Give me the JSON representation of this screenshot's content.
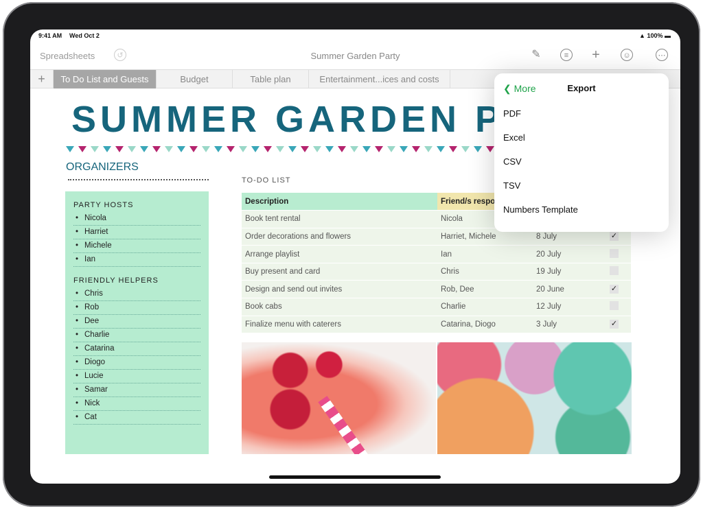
{
  "status": {
    "time": "9:41 AM",
    "date": "Wed Oct 2",
    "battery": "100%"
  },
  "toolbar": {
    "back": "Spreadsheets",
    "title": "Summer Garden Party"
  },
  "icons": [
    "undo-icon",
    "paintbrush-icon",
    "filter-icon",
    "plus-icon",
    "collaborate-icon",
    "more-icon"
  ],
  "tabs": [
    "To Do List and Guests",
    "Budget",
    "Table plan",
    "Entertainment...ices and costs"
  ],
  "doc": {
    "title": "SUMMER GARDEN PARTY",
    "organizers": "ORGANIZERS",
    "sections": [
      {
        "heading": "PARTY HOSTS",
        "names": [
          "Nicola",
          "Harriet",
          "Michele",
          "Ian"
        ]
      },
      {
        "heading": "FRIENDLY HELPERS",
        "names": [
          "Chris",
          "Rob",
          "Dee",
          "Charlie",
          "Catarina",
          "Diogo",
          "Lucie",
          "Samar",
          "Nick",
          "Cat"
        ]
      }
    ],
    "todo_heading": "TO-DO LIST",
    "columns": [
      "Description",
      "Friend/s responsible",
      "",
      ""
    ],
    "rows": [
      {
        "desc": "Book tent rental",
        "friend": "Nicola",
        "date": "",
        "done": false
      },
      {
        "desc": "Order decorations and flowers",
        "friend": "Harriet, Michele",
        "date": "8 July",
        "done": true
      },
      {
        "desc": "Arrange playlist",
        "friend": "Ian",
        "date": "20 July",
        "done": false
      },
      {
        "desc": "Buy present and card",
        "friend": "Chris",
        "date": "19 July",
        "done": false
      },
      {
        "desc": "Design and send out invites",
        "friend": "Rob, Dee",
        "date": "20 June",
        "done": true
      },
      {
        "desc": "Book cabs",
        "friend": "Charlie",
        "date": "12 July",
        "done": false
      },
      {
        "desc": "Finalize menu with caterers",
        "friend": "Catarina, Diogo",
        "date": "3 July",
        "done": true
      }
    ]
  },
  "popover": {
    "back": "More",
    "title": "Export",
    "items": [
      "PDF",
      "Excel",
      "CSV",
      "TSV",
      "Numbers Template"
    ]
  },
  "colors": {
    "accent": "#16657c",
    "panel": "#b6ecd0",
    "link": "#1fa34a",
    "bunting": [
      "#3aa7b8",
      "#b5246e",
      "#9ad8c8"
    ]
  }
}
